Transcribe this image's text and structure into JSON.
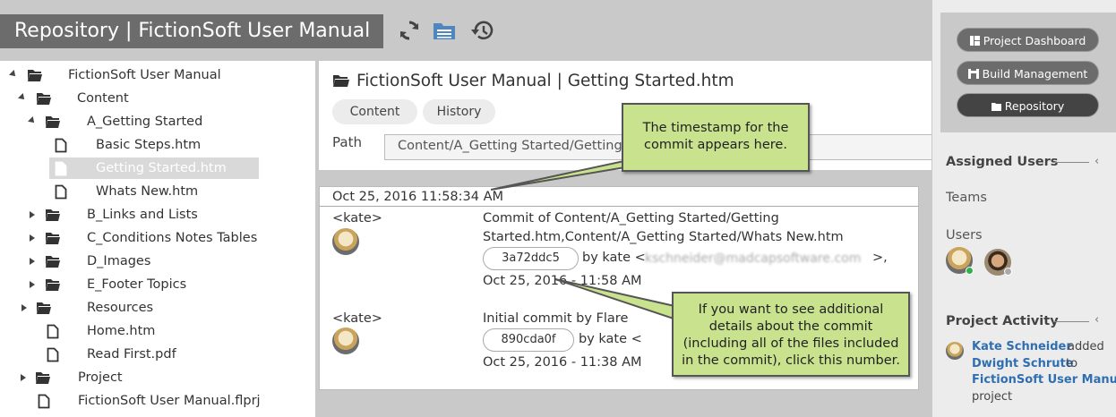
{
  "header": {
    "title": "Repository | FictionSoft User Manual"
  },
  "tree": {
    "items": [
      {
        "label": "FictionSoft User Manual",
        "type": "folder-open"
      },
      {
        "label": "Content",
        "type": "folder-open"
      },
      {
        "label": "A_Getting Started",
        "type": "folder-open"
      },
      {
        "label": "Basic Steps.htm",
        "type": "file"
      },
      {
        "label": "Getting Started.htm",
        "type": "file",
        "selected": true
      },
      {
        "label": "Whats New.htm",
        "type": "file"
      },
      {
        "label": "B_Links and Lists",
        "type": "folder"
      },
      {
        "label": "C_Conditions Notes Tables",
        "type": "folder"
      },
      {
        "label": "D_Images",
        "type": "folder"
      },
      {
        "label": "E_Footer Topics",
        "type": "folder"
      },
      {
        "label": "Resources",
        "type": "folder"
      },
      {
        "label": "Home.htm",
        "type": "file"
      },
      {
        "label": "Read First.pdf",
        "type": "file"
      },
      {
        "label": "Project",
        "type": "folder"
      },
      {
        "label": "FictionSoft User Manual.flprj",
        "type": "file"
      }
    ]
  },
  "main": {
    "title": "FictionSoft User Manual | Getting Started.htm",
    "tabs": [
      {
        "label": "Content"
      },
      {
        "label": "History"
      }
    ],
    "path_label": "Path",
    "path_value": "Content/A_Getting Started/Getting Started.htm",
    "timestamp": "Oct 25, 2016 11:58:34 AM",
    "commits": [
      {
        "author": "<kate>",
        "message_line1": "Commit of Content/A_Getting Started/Getting",
        "message_line2": "Started.htm,Content/A_Getting Started/Whats New.htm",
        "hash": "3a72ddc5",
        "by": "by kate <",
        "email": "kschneider@madcapsoftware.com",
        "email_suffix": ">,",
        "date": "Oct 25, 2016 - 11:58 AM"
      },
      {
        "author": "<kate>",
        "message_line1": "Initial commit by Flare",
        "hash": "890cda0f",
        "by": "by kate <",
        "date": "Oct 25, 2016 - 11:38 AM"
      }
    ]
  },
  "right_panel": {
    "nav": [
      {
        "label": "Project Dashboard",
        "icon": "dashboard-icon"
      },
      {
        "label": "Build Management",
        "icon": "build-icon"
      },
      {
        "label": "Repository",
        "icon": "repository-icon",
        "active": true
      }
    ],
    "assigned_users_heading": "Assigned Users",
    "teams_label": "Teams",
    "users_label": "Users",
    "activity_heading": "Project Activity",
    "activity": {
      "user": "Kate Schneider",
      "verb": "added",
      "target_user": "Dwight Schrute",
      "to": "to",
      "project_name": "FictionSoft User Manual",
      "project_word": "project"
    }
  },
  "callouts": {
    "timestamp": "The timestamp for the commit appears here.",
    "details": "If you want to see additional details about the commit (including all of the files included in the commit), click this number."
  },
  "colors": {
    "title_bg": "#6c6c6c",
    "chrome_gray": "#c9c9c9",
    "callout_green": "#c8e28e",
    "link_blue": "#2f6fb1"
  }
}
